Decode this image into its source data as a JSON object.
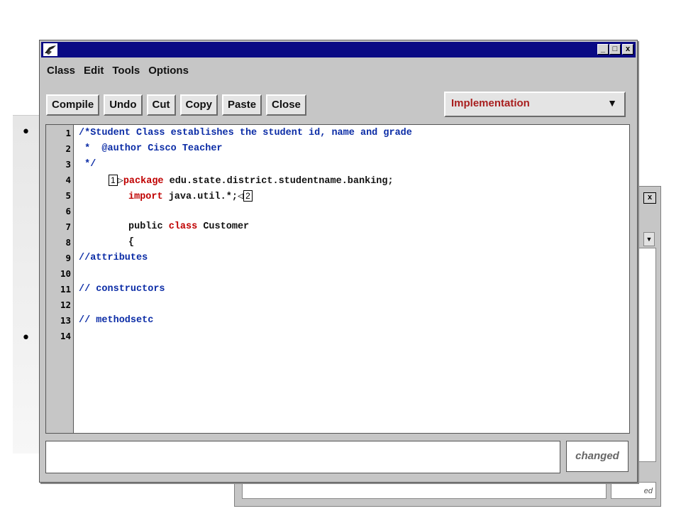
{
  "slide": {
    "bullets": [
      "•",
      "•"
    ]
  },
  "background_window": {
    "close": "x",
    "dropdown_arrow": "▼",
    "status_tail": "ed"
  },
  "window": {
    "controls": {
      "minimize": "_",
      "maximize": "□",
      "close": "x"
    }
  },
  "menu": [
    "Class",
    "Edit",
    "Tools",
    "Options"
  ],
  "toolbar": {
    "compile": "Compile",
    "undo": "Undo",
    "cut": "Cut",
    "copy": "Copy",
    "paste": "Paste",
    "close": "Close"
  },
  "view_selector": {
    "value": "Implementation",
    "arrow": "▼"
  },
  "editor": {
    "line_numbers": [
      "1",
      "2",
      "3",
      "4",
      "5",
      "6",
      "7",
      "8",
      "9",
      "10",
      "11",
      "12",
      "13",
      "14"
    ],
    "lines": {
      "l1": "/*Student Class establishes the student id, name and grade",
      "l2": " *  @author Cisco Teacher",
      "l3": " */",
      "l4_marker": "1",
      "l4_kw": "package",
      "l4_rest": " edu.state.district.studentname.banking;",
      "l5_kw": "import",
      "l5_rest": " java.util.*;",
      "l5_marker": "2",
      "l7_pre": "public ",
      "l7_kw": "class",
      "l7_rest": " Customer",
      "l8": "{",
      "l9": "//attributes",
      "l11": "// constructors",
      "l13": "// methodsetc"
    }
  },
  "status": {
    "message": "",
    "changed": "changed"
  },
  "colors": {
    "titlebar": "#0a0a84",
    "keyword": "#c00000",
    "comment": "#0b2ca6",
    "view_label": "#a81e1e"
  }
}
